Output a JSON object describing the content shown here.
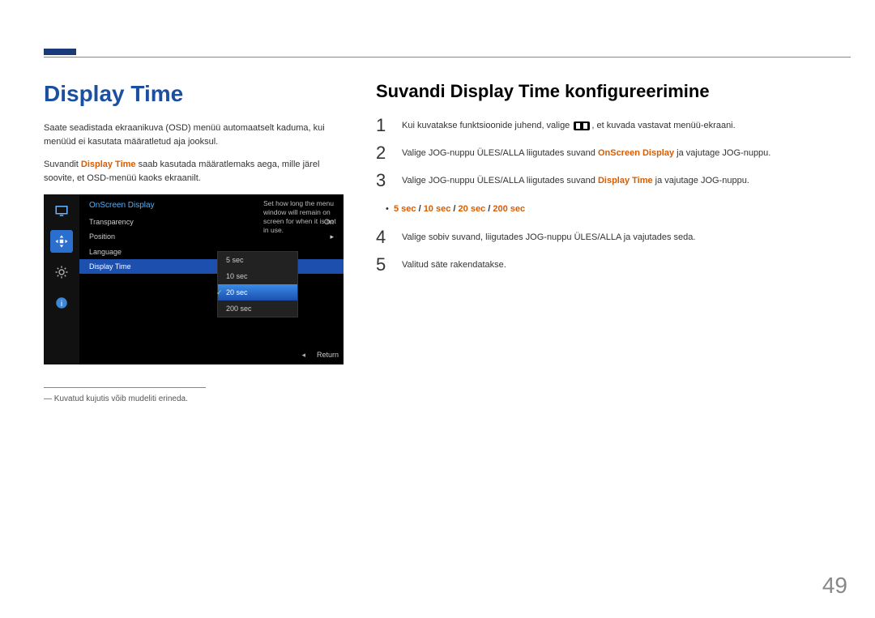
{
  "left": {
    "heading": "Display Time",
    "para1": "Saate seadistada ekraanikuva (OSD) menüü automaatselt kaduma, kui menüüd ei kasutata määratletud aja jooksul.",
    "para2_pre": "Suvandit ",
    "para2_hl": "Display Time",
    "para2_post": " saab kasutada määratlemaks aega, mille järel soovite, et OSD-menüü kaoks ekraanilt.",
    "footnote": "― Kuvatud kujutis võib mudeliti erineda."
  },
  "osd": {
    "title": "OnScreen Display",
    "items": [
      {
        "label": "Transparency",
        "value": "On"
      },
      {
        "label": "Position",
        "value": "▸"
      },
      {
        "label": "Language",
        "value": ""
      },
      {
        "label": "Display Time",
        "value": ""
      }
    ],
    "help": "Set how long the menu window will remain on screen for when it is not in use.",
    "options": [
      "5 sec",
      "10 sec",
      "20 sec",
      "200 sec"
    ],
    "selected_option": "20 sec",
    "return": "Return"
  },
  "right": {
    "heading": "Suvandi Display Time konfigureerimine",
    "steps": [
      {
        "n": "1",
        "pre": "Kui kuvatakse funktsioonide juhend, valige ",
        "icon": true,
        "post": ", et kuvada vastavat menüü-ekraani."
      },
      {
        "n": "2",
        "pre": "Valige JOG-nuppu ÜLES/ALLA liigutades suvand ",
        "hl": "OnScreen Display",
        "post": " ja vajutage JOG-nuppu."
      },
      {
        "n": "3",
        "pre": "Valige JOG-nuppu ÜLES/ALLA liigutades suvand ",
        "hl": "Display Time",
        "post": " ja vajutage JOG-nuppu."
      },
      {
        "n": "4",
        "text": "Valige sobiv suvand, liigutades JOG-nuppu ÜLES/ALLA ja vajutades seda."
      },
      {
        "n": "5",
        "text": "Valitud säte rakendatakse."
      }
    ],
    "options": [
      "5 sec",
      "10 sec",
      "20 sec",
      "200 sec"
    ]
  },
  "page": "49"
}
